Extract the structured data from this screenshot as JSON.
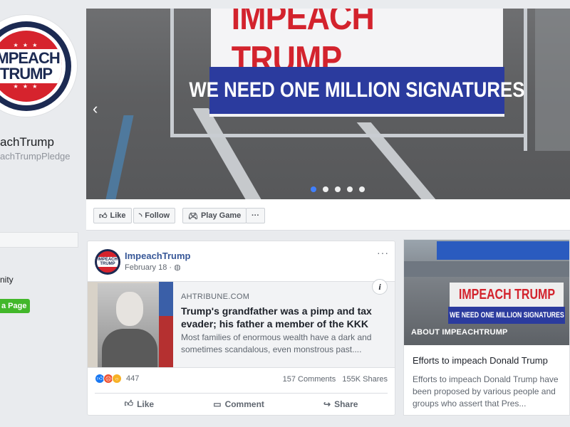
{
  "profile": {
    "logo_line1": "IMPEACH",
    "logo_line2": "TRUMP",
    "logo_stars": "★ ★ ★",
    "name": "achTrump",
    "handle": "achTrumpPledge",
    "community_label": "nity",
    "create_page_label": "a Page"
  },
  "cover": {
    "sign_top": "IMPEACH TRUMP",
    "sign_bottom": "WE NEED ONE MILLION SIGNATURES",
    "prev_arrow": "‹",
    "slides": 5,
    "active_slide": 0
  },
  "actions": {
    "like": "Like",
    "follow": "Follow",
    "play_game": "Play Game",
    "more": "···"
  },
  "post": {
    "author": "ImpeachTrump",
    "date": "February 18 · ",
    "privacy_icon": "globe-icon",
    "more": "···",
    "link_domain": "AHTRIBUNE.COM",
    "link_title": "Trump's grandfather was a pimp and tax evader; his father a member of the KKK",
    "link_desc": "Most families of enormous wealth have a dark and sometimes scandalous, even monstrous past....",
    "info": "i",
    "reaction_count": "447",
    "comments": "157 Comments",
    "shares": "155K Shares",
    "like_label": "Like",
    "comment_label": "Comment",
    "share_label": "Share"
  },
  "about": {
    "image_sign_top": "IMPEACH TRUMP",
    "image_sign_bottom": "WE NEED ONE MILLION SIGNATURES",
    "label": "ABOUT IMPEACHTRUMP",
    "title": "Efforts to impeach Donald Trump",
    "body": "Efforts to impeach Donald Trump have been proposed by various people and groups who assert that Pres..."
  },
  "colors": {
    "fb_blue": "#385898",
    "impeach_red": "#d3232d",
    "sign_blue": "#2b3b9e",
    "create_green": "#42b72a"
  }
}
